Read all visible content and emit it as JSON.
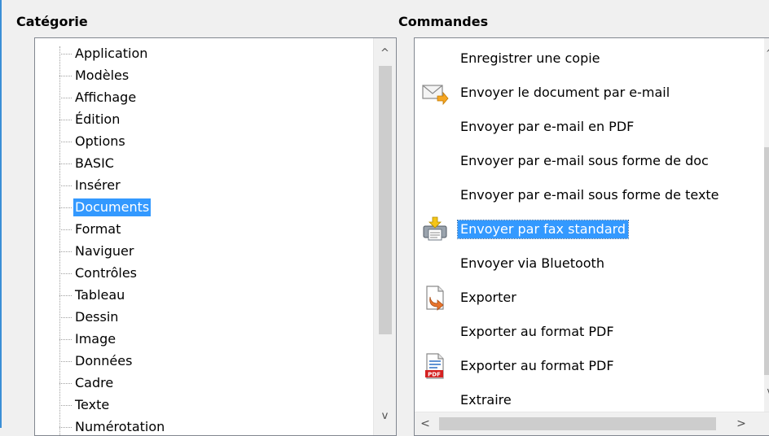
{
  "category": {
    "label": "Catégorie",
    "items": [
      {
        "label": "Application",
        "selected": false
      },
      {
        "label": "Modèles",
        "selected": false
      },
      {
        "label": "Affichage",
        "selected": false
      },
      {
        "label": "Édition",
        "selected": false
      },
      {
        "label": "Options",
        "selected": false
      },
      {
        "label": "BASIC",
        "selected": false
      },
      {
        "label": "Insérer",
        "selected": false
      },
      {
        "label": "Documents",
        "selected": true
      },
      {
        "label": "Format",
        "selected": false
      },
      {
        "label": "Naviguer",
        "selected": false
      },
      {
        "label": "Contrôles",
        "selected": false
      },
      {
        "label": "Tableau",
        "selected": false
      },
      {
        "label": "Dessin",
        "selected": false
      },
      {
        "label": "Image",
        "selected": false
      },
      {
        "label": "Données",
        "selected": false
      },
      {
        "label": "Cadre",
        "selected": false
      },
      {
        "label": "Texte",
        "selected": false
      },
      {
        "label": "Numérotation",
        "selected": false
      }
    ]
  },
  "commands": {
    "label": "Commandes",
    "items": [
      {
        "label": "Enregistrer une copie",
        "icon": null,
        "selected": false
      },
      {
        "label": "Envoyer le document par e-mail",
        "icon": "envelope-send-icon",
        "selected": false
      },
      {
        "label": "Envoyer par e-mail en PDF",
        "icon": null,
        "selected": false
      },
      {
        "label": "Envoyer par e-mail sous forme de doc",
        "icon": null,
        "selected": false
      },
      {
        "label": "Envoyer par e-mail sous forme de texte",
        "icon": null,
        "selected": false
      },
      {
        "label": "Envoyer par fax standard",
        "icon": "fax-icon",
        "selected": true
      },
      {
        "label": "Envoyer via Bluetooth",
        "icon": null,
        "selected": false
      },
      {
        "label": "Exporter",
        "icon": "export-icon",
        "selected": false
      },
      {
        "label": "Exporter au format PDF",
        "icon": null,
        "selected": false
      },
      {
        "label": "Exporter au format PDF",
        "icon": "pdf-icon",
        "selected": false
      },
      {
        "label": "Extraire",
        "icon": null,
        "selected": false
      }
    ]
  },
  "scroll": {
    "up": "^",
    "down": "v",
    "left": "<",
    "right": ">"
  },
  "colors": {
    "selection": "#3399ff",
    "window_accent": "#3b8fd6"
  }
}
